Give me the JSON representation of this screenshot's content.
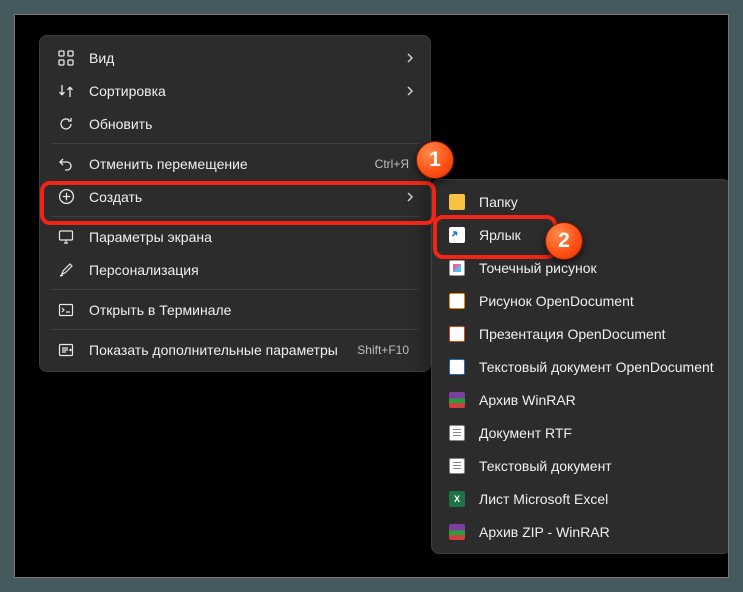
{
  "main_menu": {
    "items": [
      {
        "label": "Вид",
        "has_submenu": true
      },
      {
        "label": "Сортировка",
        "has_submenu": true
      },
      {
        "label": "Обновить",
        "has_submenu": false
      },
      {
        "label": "Отменить перемещение",
        "shortcut": "Ctrl+Я"
      },
      {
        "label": "Создать",
        "has_submenu": true
      },
      {
        "label": "Параметры экрана"
      },
      {
        "label": "Персонализация"
      },
      {
        "label": "Открыть в Терминале"
      },
      {
        "label": "Показать дополнительные параметры",
        "shortcut": "Shift+F10"
      }
    ]
  },
  "sub_menu": {
    "items": [
      {
        "label": "Папку"
      },
      {
        "label": "Ярлык"
      },
      {
        "label": "Точечный рисунок"
      },
      {
        "label": "Рисунок OpenDocument"
      },
      {
        "label": "Презентация OpenDocument"
      },
      {
        "label": "Текстовый документ OpenDocument"
      },
      {
        "label": "Архив WinRAR"
      },
      {
        "label": "Документ RTF"
      },
      {
        "label": "Текстовый документ"
      },
      {
        "label": "Лист Microsoft Excel"
      },
      {
        "label": "Архив ZIP - WinRAR"
      }
    ]
  },
  "badges": {
    "one": "1",
    "two": "2"
  }
}
